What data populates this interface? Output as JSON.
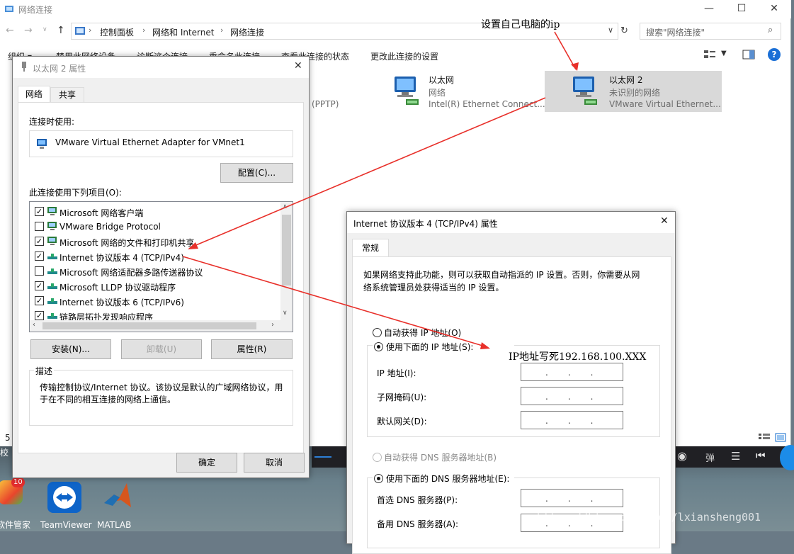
{
  "explorer": {
    "title": "网络连接",
    "nav": {
      "back": "←",
      "forward": "→",
      "up": "↑"
    },
    "breadcrumb": [
      "控制面板",
      "网络和 Internet",
      "网络连接"
    ],
    "search_placeholder": "搜索\"网络连接\"",
    "commands": [
      "组织 ▾",
      "禁用此网络设备",
      "诊断这个连接",
      "重命名此连接",
      "查看此连接的状态",
      "更改此连接的设置"
    ],
    "connections": [
      {
        "partial": "(PPTP)"
      },
      {
        "name": "以太网",
        "status": "网络",
        "adapter": "Intel(R) Ethernet Connect..."
      },
      {
        "name": "以太网 2",
        "status": "未识别的网络",
        "adapter": "VMware Virtual Ethernet..."
      }
    ],
    "status_left": "5"
  },
  "annotation_top": "设置自己电脑的ip",
  "annotation_ip": "IP地址写死192.168.100.XXX",
  "watermark": "https://blog.csdn.net/lxiansheng001",
  "props_dialog": {
    "title": "以太网 2 属性",
    "tabs": [
      "网络",
      "共享"
    ],
    "connect_using_label": "连接时使用:",
    "adapter_name": "VMware Virtual Ethernet Adapter for VMnet1",
    "configure_button": "配置(C)...",
    "items_label": "此连接使用下列项目(O):",
    "items": [
      {
        "checked": true,
        "label": "Microsoft 网络客户端"
      },
      {
        "checked": false,
        "label": "VMware Bridge Protocol"
      },
      {
        "checked": true,
        "label": "Microsoft 网络的文件和打印机共享"
      },
      {
        "checked": true,
        "label": "Internet 协议版本 4 (TCP/IPv4)"
      },
      {
        "checked": false,
        "label": "Microsoft 网络适配器多路传送器协议"
      },
      {
        "checked": true,
        "label": "Microsoft LLDP 协议驱动程序"
      },
      {
        "checked": true,
        "label": "Internet 协议版本 6 (TCP/IPv6)"
      },
      {
        "checked": true,
        "label": "链路层拓扑发现响应程序"
      }
    ],
    "install_button": "安装(N)...",
    "uninstall_button": "卸载(U)",
    "properties_button": "属性(R)",
    "description_label": "描述",
    "description": "传输控制协议/Internet 协议。该协议是默认的广域网络协议，用于在不同的相互连接的网络上通信。",
    "ok_button": "确定",
    "cancel_button": "取消"
  },
  "ipv4_dialog": {
    "title": "Internet 协议版本 4 (TCP/IPv4) 属性",
    "tab": "常规",
    "intro": "如果网络支持此功能，则可以获取自动指派的 IP 设置。否则，你需要从网络系统管理员处获得适当的 IP 设置。",
    "auto_ip": "自动获得 IP 地址(O)",
    "manual_ip": "使用下面的 IP 地址(S):",
    "ip_label": "IP 地址(I):",
    "mask_label": "子网掩码(U):",
    "gateway_label": "默认网关(D):",
    "auto_dns": "自动获得 DNS 服务器地址(B)",
    "manual_dns": "使用下面的 DNS 服务器地址(E):",
    "dns1_label": "首选 DNS 服务器(P):",
    "dns2_label": "备用 DNS 服务器(A):",
    "ip_dots": "...",
    "selected_ip_mode": "manual",
    "selected_dns_mode": "manual"
  },
  "desktop": {
    "icons": [
      {
        "label": "软件管家",
        "badge": "10"
      },
      {
        "label": "TeamViewer"
      },
      {
        "label": "MATLAB"
      }
    ],
    "left_frag": "校",
    "player_controls": [
      "弹"
    ]
  },
  "colors": {
    "arrow": "#e8302a",
    "selected_tile": "#d9d9d9",
    "accent": "#0a64c8"
  }
}
